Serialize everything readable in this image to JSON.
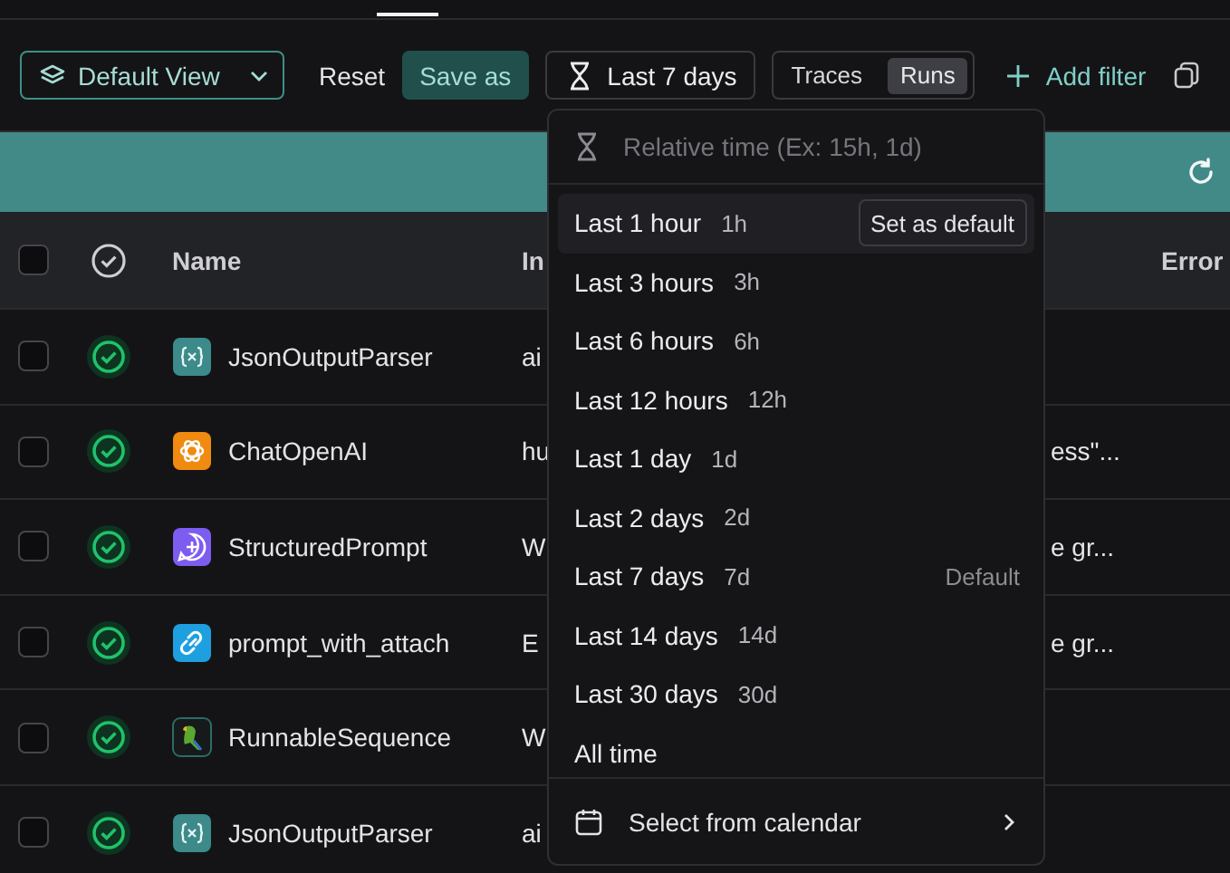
{
  "toolbar": {
    "view_button": "Default View",
    "reset": "Reset",
    "save_as": "Save as",
    "time_button": "Last 7 days",
    "mode_toggle": [
      {
        "label": "Traces",
        "selected": false
      },
      {
        "label": "Runs",
        "selected": true
      }
    ],
    "add_filter": "Add filter"
  },
  "table": {
    "columns": [
      "Name",
      "In",
      "Error"
    ],
    "header_checked": false,
    "rows": [
      {
        "checked": false,
        "succeeded": true,
        "kind": "parser",
        "name": "JsonOutputParser",
        "input_start": "ai"
      },
      {
        "checked": false,
        "succeeded": true,
        "kind": "llm",
        "name": "ChatOpenAI",
        "input_start": "hu",
        "input_end": "ess\"..."
      },
      {
        "checked": false,
        "succeeded": true,
        "kind": "prompt",
        "name": "StructuredPrompt",
        "input_start": "W",
        "input_end": "e gr..."
      },
      {
        "checked": false,
        "succeeded": true,
        "kind": "link",
        "name": "prompt_with_attach",
        "input_start": "E",
        "input_end": "e gr..."
      },
      {
        "checked": false,
        "succeeded": true,
        "kind": "parrot",
        "name": "RunnableSequence",
        "input_start": "W"
      },
      {
        "checked": false,
        "succeeded": true,
        "kind": "parser",
        "name": "JsonOutputParser",
        "input_start": "ai"
      }
    ]
  },
  "time_menu": {
    "placeholder": "Relative time (Ex: 15h, 1d)",
    "items": [
      {
        "label": "Last 1 hour",
        "short": "1h",
        "highlighted": true,
        "action": "Set as default"
      },
      {
        "label": "Last 3 hours",
        "short": "3h",
        "highlighted": false
      },
      {
        "label": "Last 6 hours",
        "short": "6h",
        "highlighted": false
      },
      {
        "label": "Last 12 hours",
        "short": "12h",
        "highlighted": false
      },
      {
        "label": "Last 1 day",
        "short": "1d",
        "highlighted": false
      },
      {
        "label": "Last 2 days",
        "short": "2d",
        "highlighted": false
      },
      {
        "label": "Last 7 days",
        "short": "7d",
        "highlighted": false,
        "tag": "Default"
      },
      {
        "label": "Last 14 days",
        "short": "14d",
        "highlighted": false
      },
      {
        "label": "Last 30 days",
        "short": "30d",
        "highlighted": false
      },
      {
        "label": "All time",
        "highlighted": false
      }
    ],
    "calendar": "Select from calendar"
  }
}
